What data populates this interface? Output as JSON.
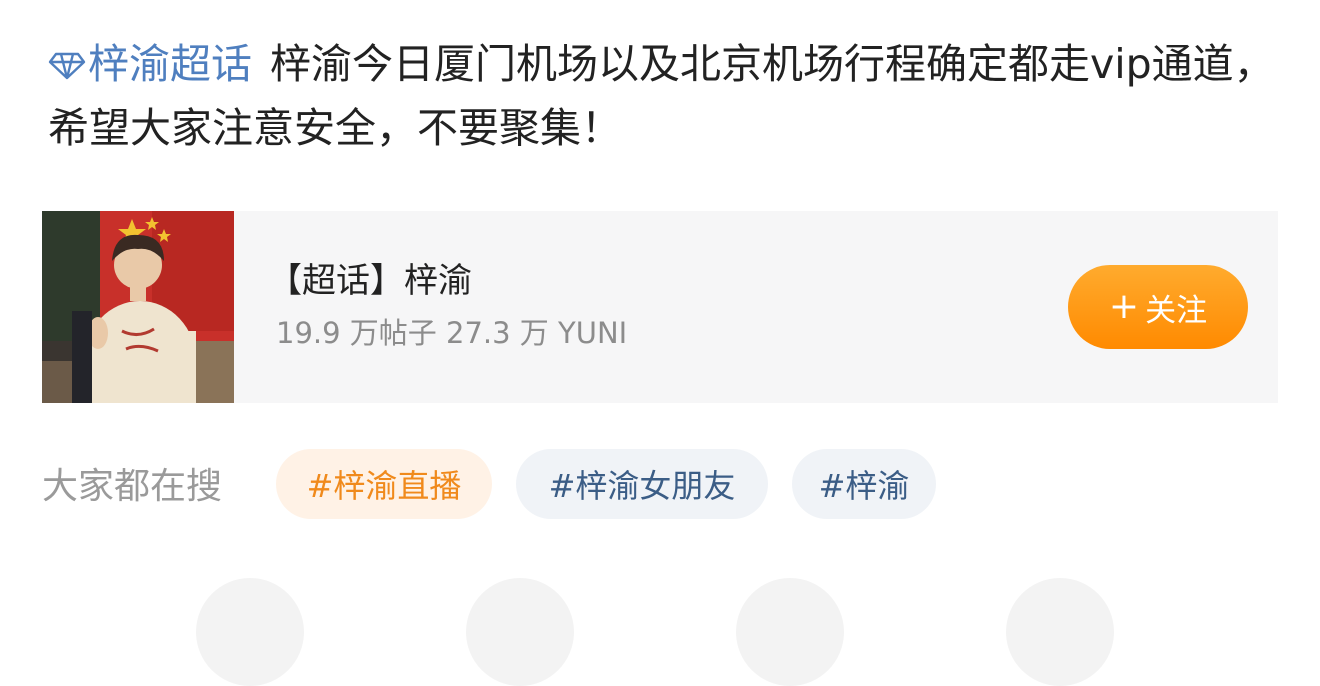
{
  "post": {
    "topic_label": "梓渝超话",
    "body": "梓渝今日厦门机场以及北京机场行程确定都走vip通道，希望大家注意安全，不要聚集！"
  },
  "card": {
    "title": "【超话】梓渝",
    "stats": "19.9 万帖子 27.3 万 YUNI",
    "follow_label": "关注",
    "follow_icon": "plus-icon"
  },
  "search": {
    "label": "大家都在搜",
    "tags": [
      "#梓渝直播",
      "#梓渝女朋友",
      "#梓渝"
    ]
  },
  "colors": {
    "link_blue": "#4f7fbf",
    "follow_orange": "#ff8a00",
    "hot_tag_text": "#f08a1c",
    "tag_text": "#3b5d86"
  }
}
